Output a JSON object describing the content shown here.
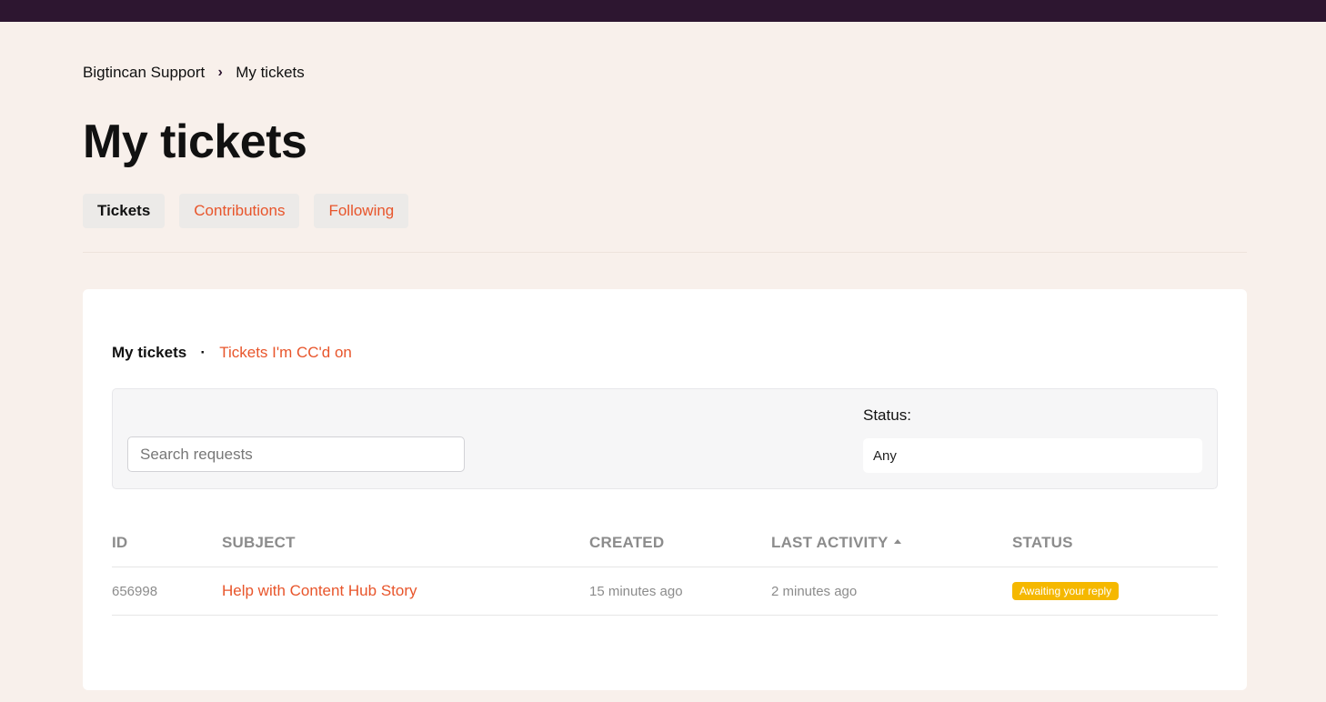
{
  "breadcrumb": {
    "root": "Bigtincan Support",
    "current": "My tickets"
  },
  "page": {
    "title": "My tickets"
  },
  "tabs": [
    {
      "label": "Tickets",
      "active": true
    },
    {
      "label": "Contributions",
      "active": false
    },
    {
      "label": "Following",
      "active": false
    }
  ],
  "subnav": {
    "current": "My tickets",
    "other": "Tickets I'm CC'd on"
  },
  "filters": {
    "search_placeholder": "Search requests",
    "status_label": "Status:",
    "status_value": "Any"
  },
  "table": {
    "headers": {
      "id": "ID",
      "subject": "SUBJECT",
      "created": "CREATED",
      "last_activity": "LAST ACTIVITY",
      "status": "STATUS"
    },
    "rows": [
      {
        "id": "656998",
        "subject": "Help with Content Hub Story",
        "created": "15 minutes ago",
        "last_activity": "2 minutes ago",
        "status": "Awaiting your reply"
      }
    ]
  },
  "colors": {
    "topbar": "#2d1630",
    "background": "#f8f0eb",
    "accent": "#e8552b",
    "badge": "#f5b800"
  }
}
